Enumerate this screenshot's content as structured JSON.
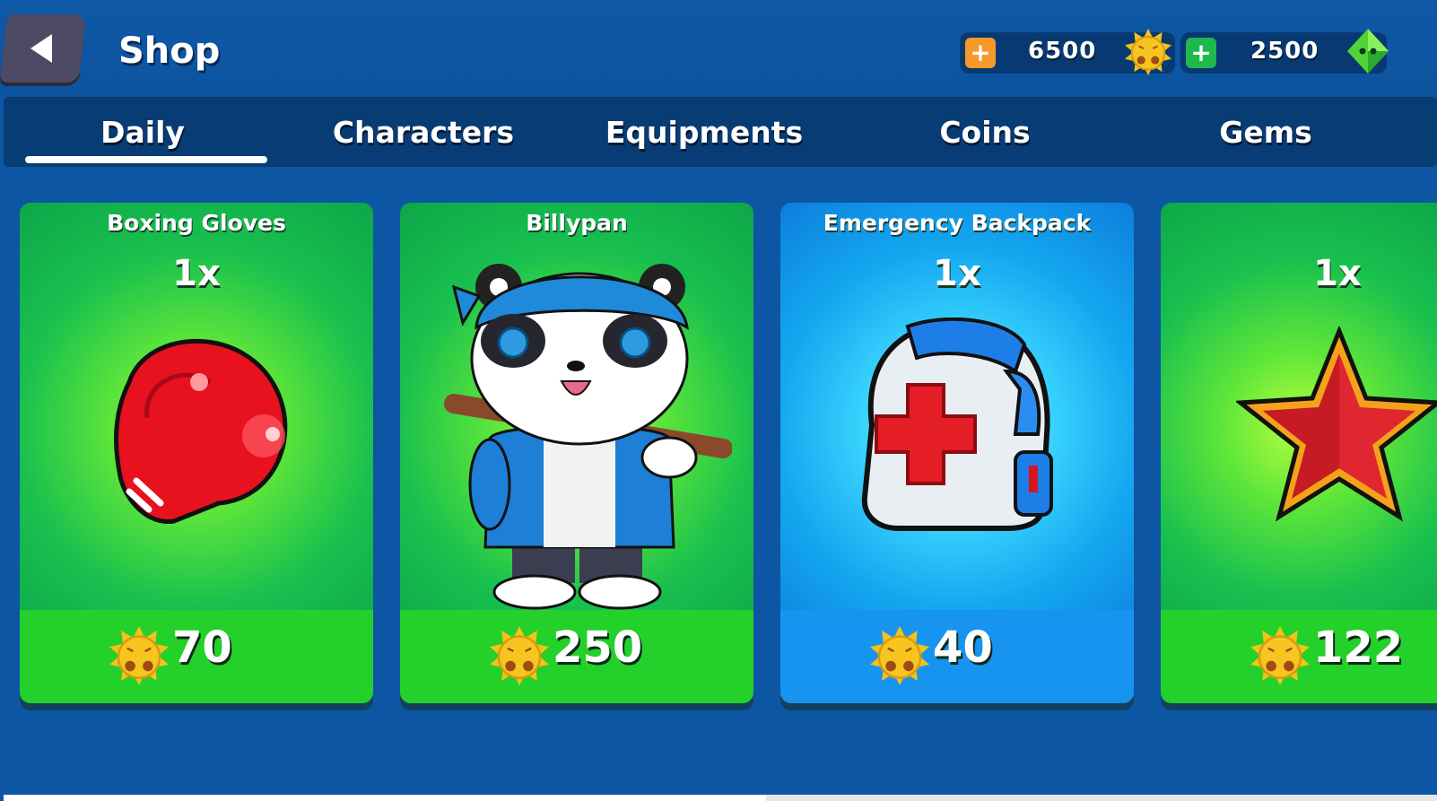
{
  "header": {
    "title": "Shop",
    "back_icon": "back-arrow-icon"
  },
  "currencies": [
    {
      "name": "coins",
      "value": "6500",
      "icon": "spiky-coin-icon",
      "add_icon": "plus-icon",
      "color": "#f59a2a"
    },
    {
      "name": "gems",
      "value": "2500",
      "icon": "green-gem-icon",
      "add_icon": "plus-icon",
      "color": "#1fb84c"
    }
  ],
  "tabs": [
    {
      "label": "Daily",
      "active": true
    },
    {
      "label": "Characters",
      "active": false
    },
    {
      "label": "Equipments",
      "active": false
    },
    {
      "label": "Coins",
      "active": false
    },
    {
      "label": "Gems",
      "active": false
    }
  ],
  "cards": [
    {
      "title": "Boxing Gloves",
      "qty": "1x",
      "price": "70",
      "art": "boxing-glove-icon",
      "theme": "green"
    },
    {
      "title": "Billypan",
      "qty": "",
      "price": "250",
      "art": "panda-character-icon",
      "theme": "green"
    },
    {
      "title": "Emergency Backpack",
      "qty": "1x",
      "price": "40",
      "art": "medical-backpack-icon",
      "theme": "blue"
    },
    {
      "title": "",
      "qty": "1x",
      "price": "122",
      "art": "red-star-icon",
      "theme": "green"
    }
  ],
  "colors": {
    "background": "#0d56a3",
    "tabbar": "#083c75",
    "card_green": "#18c04e",
    "card_blue": "#14a7f0"
  }
}
